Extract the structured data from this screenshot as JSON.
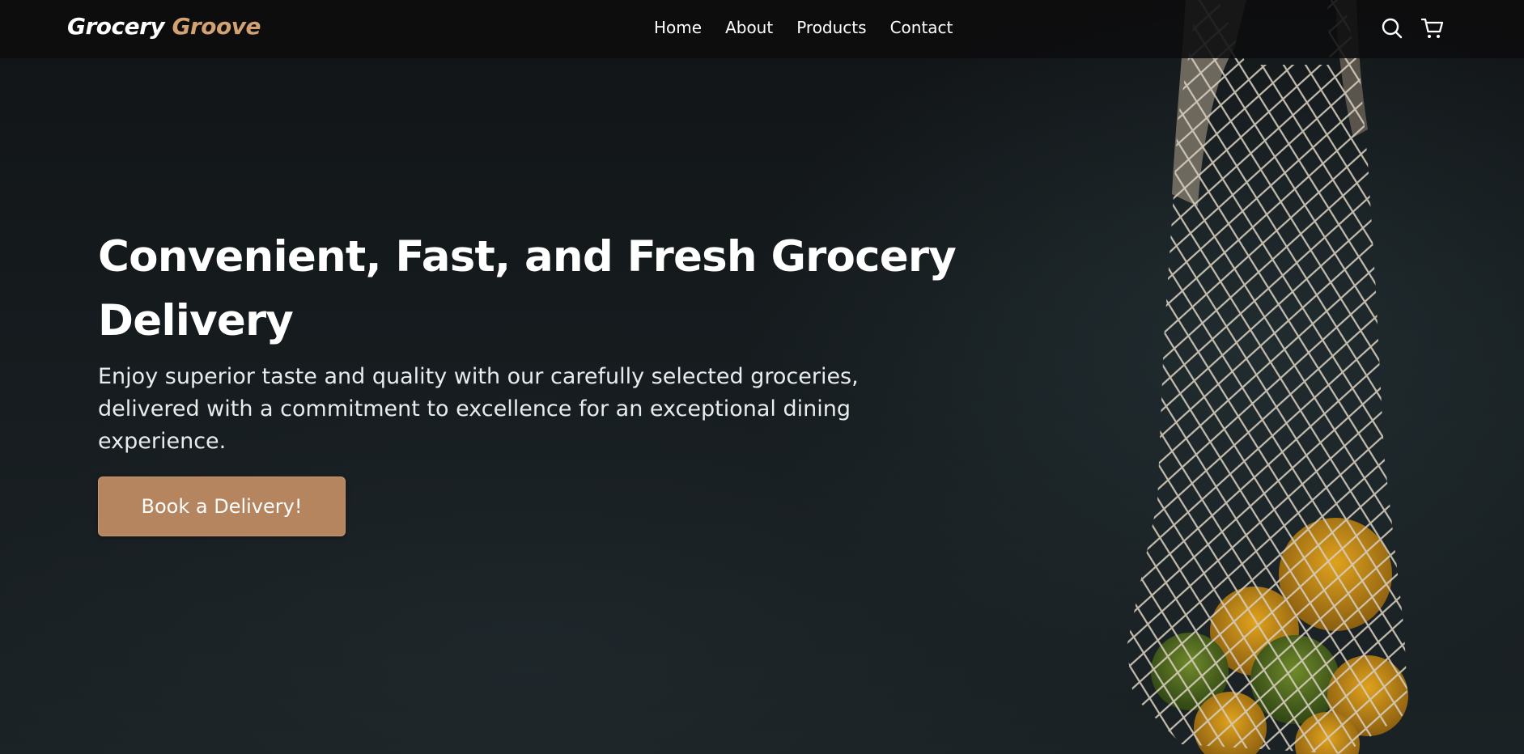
{
  "brand": {
    "name_part1": "Grocery",
    "name_part2": "Groove"
  },
  "nav": {
    "links": [
      "Home",
      "About",
      "Products",
      "Contact"
    ]
  },
  "icons": {
    "search": "search-icon",
    "cart": "cart-icon"
  },
  "hero": {
    "title": "Convenient, Fast, and Fresh Grocery Delivery",
    "subtitle": "Enjoy superior taste and quality with our carefully selected groceries, delivered with a commitment to excellence for an exceptional dining experience.",
    "cta_label": "Book a Delivery!"
  },
  "colors": {
    "accent": "#d3a272",
    "cta": "#b5855f",
    "background": "#121619",
    "navbar": "#0c0d0e"
  }
}
